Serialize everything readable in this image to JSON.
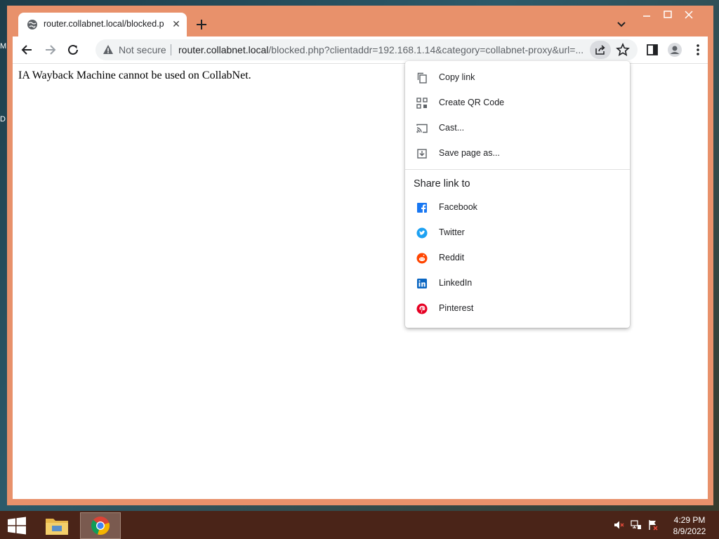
{
  "desktop": {
    "letters": [
      "M",
      "D"
    ]
  },
  "tab": {
    "title": "router.collabnet.local/blocked.php",
    "close": "✕"
  },
  "omnibox": {
    "security_label": "Not secure",
    "url_host": "router.collabnet.local",
    "url_rest": "/blocked.php?clientaddr=192.168.1.14&category=collabnet-proxy&url=..."
  },
  "page": {
    "message": "IA Wayback Machine cannot be used on CollabNet."
  },
  "share_menu": {
    "items": [
      {
        "label": "Copy link",
        "icon": "copy-icon"
      },
      {
        "label": "Create QR Code",
        "icon": "qr-code-icon"
      },
      {
        "label": "Cast...",
        "icon": "cast-icon"
      },
      {
        "label": "Save page as...",
        "icon": "save-icon"
      }
    ],
    "heading": "Share link to",
    "targets": [
      {
        "label": "Facebook",
        "icon": "facebook-icon",
        "color": "#1877f2"
      },
      {
        "label": "Twitter",
        "icon": "twitter-icon",
        "color": "#1da1f2"
      },
      {
        "label": "Reddit",
        "icon": "reddit-icon",
        "color": "#ff4500"
      },
      {
        "label": "LinkedIn",
        "icon": "linkedin-icon",
        "color": "#0a66c2"
      },
      {
        "label": "Pinterest",
        "icon": "pinterest-icon",
        "color": "#e60023"
      }
    ]
  },
  "taskbar": {
    "time": "4:29 PM",
    "date": "8/9/2022"
  },
  "colors": {
    "window_frame": "#e8916b",
    "taskbar": "#4a2418"
  }
}
